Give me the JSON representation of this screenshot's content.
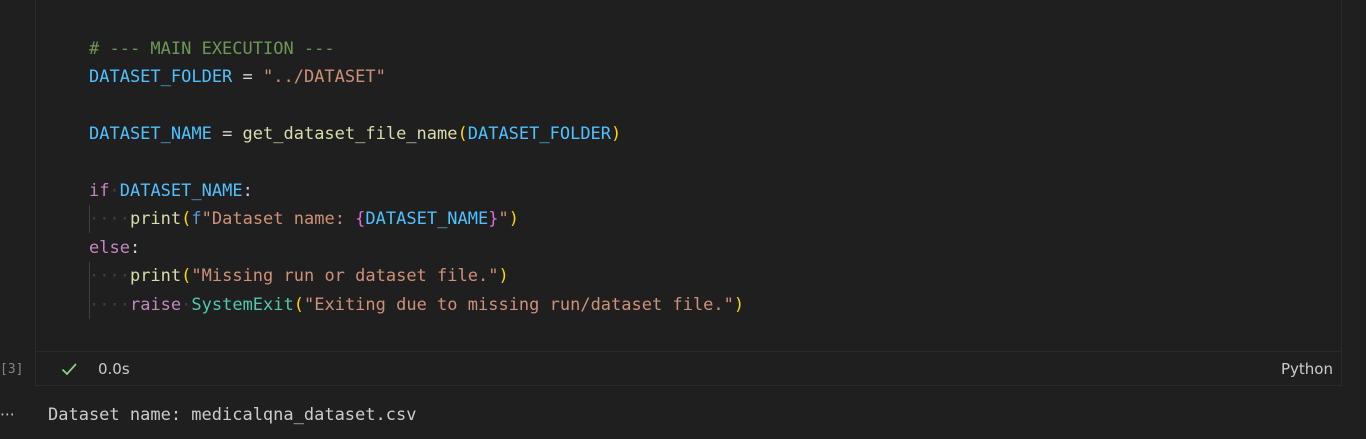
{
  "cell": {
    "execution_count": "[3]",
    "duration": "0.0s",
    "language": "Python",
    "status_icon": "check-icon",
    "code": {
      "comment": "# --- MAIN EXECUTION ---",
      "l2_var": "DATASET_FOLDER",
      "l2_op": " = ",
      "l2_str": "\"../DATASET\"",
      "l4_var": "DATASET_NAME",
      "l4_op": " = ",
      "l4_fn": "get_dataset_file_name",
      "l4_open": "(",
      "l4_arg": "DATASET_FOLDER",
      "l4_close": ")",
      "l6_kw": "if",
      "l6_var": "DATASET_NAME",
      "l6_colon": ":",
      "l7_fn": "print",
      "l7_open": "(",
      "l7_f": "f",
      "l7_str": "\"Dataset name: ",
      "l7_bopen": "{",
      "l7_var": "DATASET_NAME",
      "l7_bclose": "}",
      "l7_str2": "\"",
      "l7_close": ")",
      "l8_kw": "else",
      "l8_colon": ":",
      "l9_fn": "print",
      "l9_open": "(",
      "l9_str": "\"Missing run or dataset file.\"",
      "l9_close": ")",
      "l10_kw": "raise",
      "l10_cls": "SystemExit",
      "l10_open": "(",
      "l10_str": "\"Exiting due to missing run/dataset file.\"",
      "l10_close": ")"
    }
  },
  "output": {
    "icon": "ellipsis-icon",
    "text": "Dataset name: medicalqna_dataset.csv"
  }
}
